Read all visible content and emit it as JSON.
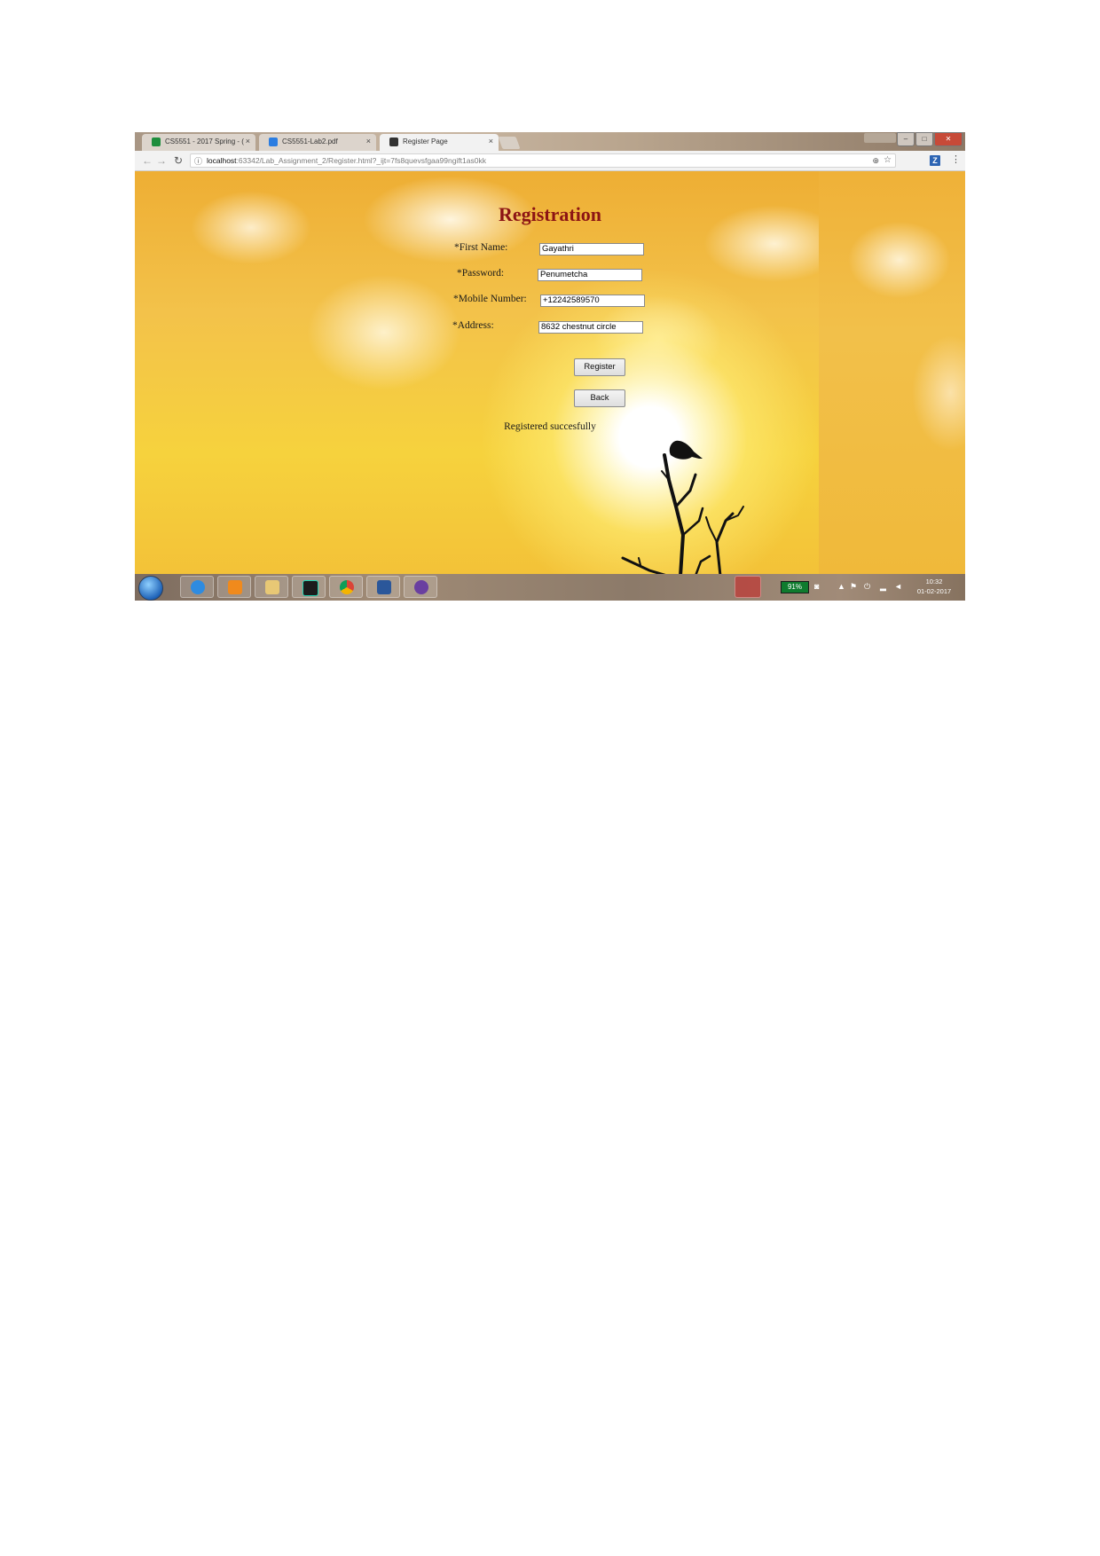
{
  "browser": {
    "tabs": [
      {
        "label": "CS5551 - 2017 Spring - (",
        "icon": "sheets-icon",
        "color": "#1e8e3e",
        "active": false
      },
      {
        "label": "CS5551-Lab2.pdf",
        "icon": "dropbox-icon",
        "color": "#2b7de1",
        "active": false
      },
      {
        "label": "Register Page",
        "icon": "webstorm-icon",
        "color": "#333333",
        "active": true
      }
    ],
    "tab_close": "×",
    "url_host": "localhost",
    "url_path": ":63342/Lab_Assignment_2/Register.html?_ijt=7fs8quevsfgaa99ngift1as0kk",
    "extension_label": "Z"
  },
  "page": {
    "title": "Registration",
    "fields": [
      {
        "label": "*First Name:",
        "value": "Gayathri"
      },
      {
        "label": "*Password:",
        "value": "Penumetcha"
      },
      {
        "label": "*Mobile Number:",
        "value": "+12242589570"
      },
      {
        "label": "*Address:",
        "value": "8632 chestnut circle"
      }
    ],
    "register_label": "Register",
    "back_label": "Back",
    "status_message": "Registered succesfully",
    "title_color": "#8c1414"
  },
  "taskbar": {
    "apps": [
      "internet-explorer-icon",
      "media-player-icon",
      "file-explorer-icon",
      "webstorm-icon",
      "chrome-icon",
      "word-icon",
      "github-icon"
    ],
    "battery": "91%",
    "time": "10:32",
    "date": "01-02-2017"
  }
}
